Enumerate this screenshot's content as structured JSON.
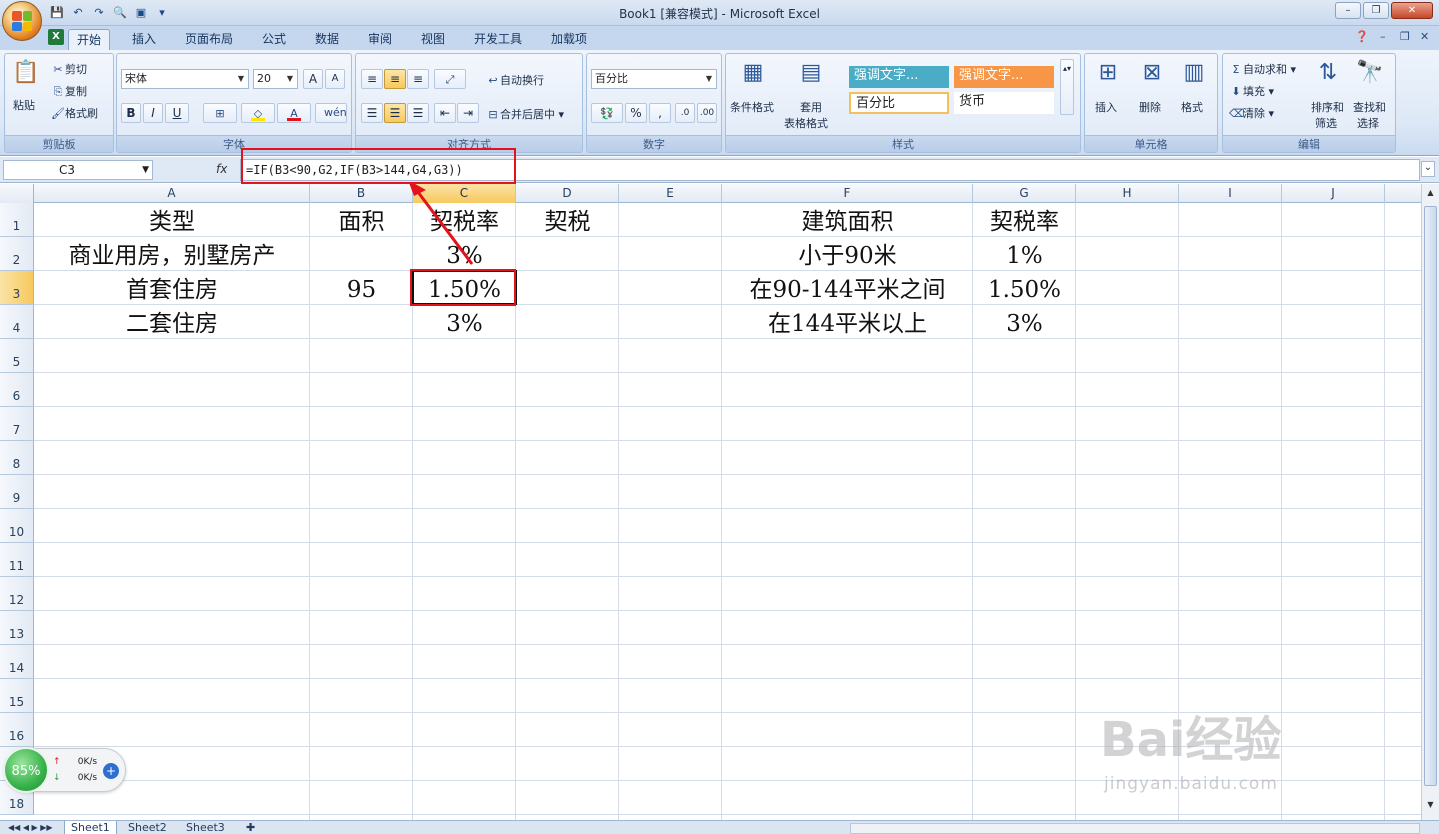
{
  "window": {
    "title": "Book1  [兼容模式] - Microsoft Excel"
  },
  "ribbon_tabs": [
    "开始",
    "插入",
    "页面布局",
    "公式",
    "数据",
    "审阅",
    "视图",
    "开发工具",
    "加载项"
  ],
  "ribbon": {
    "clipboard": {
      "paste": "粘贴",
      "cut": "剪切",
      "copy": "复制",
      "format_painter": "格式刷",
      "label": "剪贴板"
    },
    "font": {
      "name": "宋体",
      "size": "20",
      "label": "字体",
      "bold": "B",
      "italic": "I",
      "underline": "U"
    },
    "alignment": {
      "wrap": "自动换行",
      "merge": "合并后居中",
      "label": "对齐方式"
    },
    "number": {
      "format": "百分比",
      "percent": "%",
      "comma": ",",
      "label": "数字"
    },
    "styles": {
      "conditional": "条件格式",
      "table_format_1": "套用",
      "table_format_2": "表格格式",
      "cell1": "强调文字...",
      "cell2": "强调文字...",
      "cell3": "百分比",
      "cell4": "货币",
      "label": "样式"
    },
    "cells": {
      "insert": "插入",
      "delete": "删除",
      "format": "格式",
      "label": "单元格"
    },
    "editing": {
      "autosum": "自动求和",
      "fill": "填充",
      "clear": "清除",
      "sort_1": "排序和",
      "sort_2": "筛选",
      "find_1": "查找和",
      "find_2": "选择",
      "label": "编辑"
    }
  },
  "formula_bar": {
    "name_box": "C3",
    "fx": "fx",
    "formula": "=IF(B3<90,G2,IF(B3>144,G4,G3))"
  },
  "columns": [
    "A",
    "B",
    "C",
    "D",
    "E",
    "F",
    "G",
    "H",
    "I",
    "J"
  ],
  "rows": [
    "1",
    "2",
    "3",
    "4",
    "5",
    "6",
    "7",
    "8",
    "9",
    "10",
    "11",
    "12",
    "13",
    "14",
    "15",
    "16",
    "17",
    "18"
  ],
  "cells": {
    "A1": "类型",
    "B1": "面积",
    "C1": "契税率",
    "D1": "契税",
    "F1": "建筑面积",
    "G1": "契税率",
    "A2": "商业用房，别墅房产",
    "C2": "3%",
    "F2": "小于90米",
    "G2": "1%",
    "A3": "首套住房",
    "B3": "95",
    "C3": "1.50%",
    "F3": "在90-144平米之间",
    "G3": "1.50%",
    "A4": "二套住房",
    "C4": "3%",
    "F4": "在144平米以上",
    "G4": "3%"
  },
  "selected_cell": "C3",
  "sheets": [
    "Sheet1",
    "Sheet2",
    "Sheet3"
  ],
  "active_sheet": "Sheet1",
  "net_widget": {
    "percent": "85%",
    "up": "0K/s",
    "down": "0K/s"
  },
  "watermark": {
    "brand": "Bai经验",
    "url": "jingyan.baidu.com"
  },
  "colors": {
    "highlight_red": "#e2131b",
    "header_selected": "#f7c95e"
  }
}
